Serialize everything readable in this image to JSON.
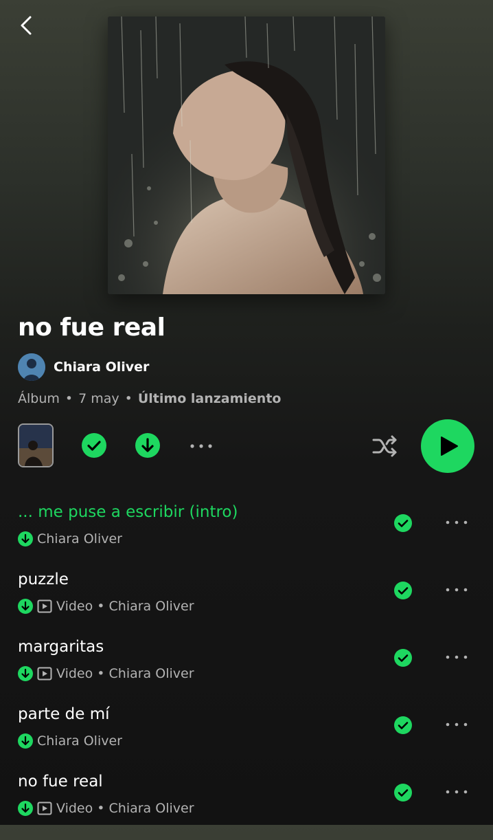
{
  "album": {
    "title": "no fue real",
    "artist": "Chiara Oliver",
    "meta": {
      "type": "Álbum",
      "date": "7 may",
      "label": "Último lanzamiento"
    }
  },
  "colors": {
    "accent": "#1ed760",
    "background": "#121212",
    "secondary_text": "#b3b3b3"
  },
  "controls": {
    "icons": [
      "album-preview-thumbnail",
      "saved-check-icon",
      "download-icon",
      "more-icon",
      "shuffle-icon",
      "play-icon"
    ]
  },
  "tracks": [
    {
      "title": "... me puse a escribir (intro)",
      "playing": true,
      "video": false,
      "subtitle": "Chiara Oliver"
    },
    {
      "title": "puzzle",
      "playing": false,
      "video": true,
      "subtitle": "Video • Chiara Oliver"
    },
    {
      "title": "margaritas",
      "playing": false,
      "video": true,
      "subtitle": "Video • Chiara Oliver"
    },
    {
      "title": "parte de mí",
      "playing": false,
      "video": false,
      "subtitle": "Chiara Oliver"
    },
    {
      "title": "no fue real",
      "playing": false,
      "video": true,
      "subtitle": "Video • Chiara Oliver"
    }
  ]
}
